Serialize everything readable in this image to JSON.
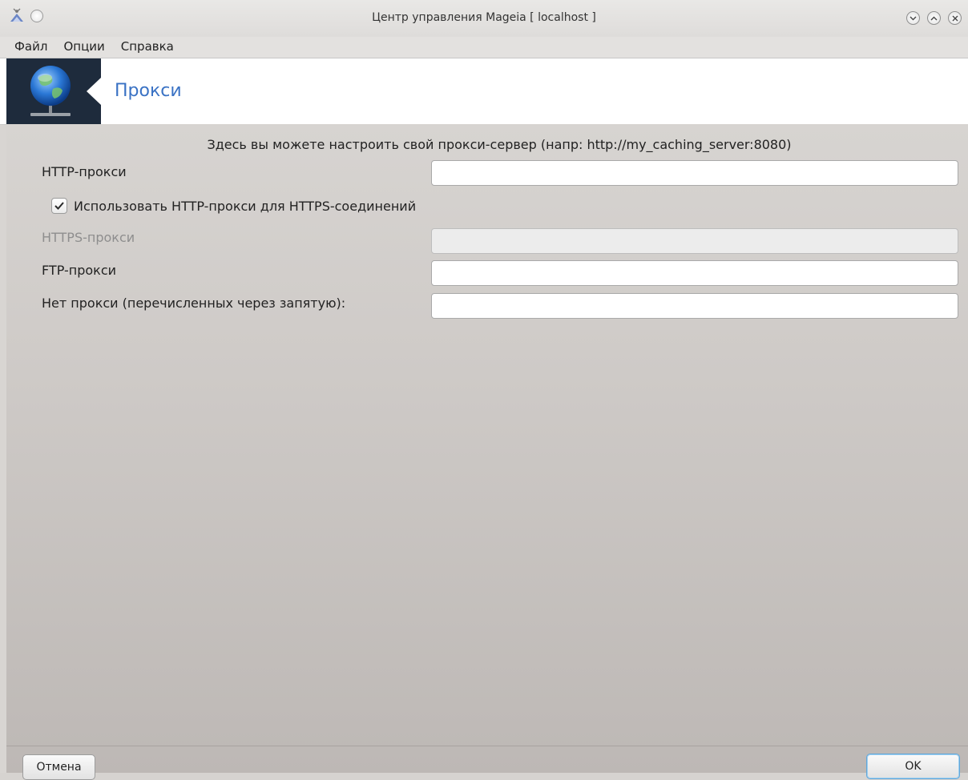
{
  "window": {
    "title": "Центр управления Mageia  [ localhost ]"
  },
  "menubar": {
    "items": [
      {
        "label": "Файл"
      },
      {
        "label": "Опции"
      },
      {
        "label": "Справка"
      }
    ]
  },
  "banner": {
    "title": "Прокси",
    "icon": "network-globe-icon"
  },
  "form": {
    "intro": "Здесь вы можете настроить свой прокси-сервер (напр: http://my_caching_server:8080)",
    "http_label": "HTTP-прокси",
    "http_value": "",
    "use_http_for_https_label": "Использовать HTTP-прокси для HTTPS-соединений",
    "use_http_for_https_checked": true,
    "https_label": "HTTPS-прокси",
    "https_value": "",
    "ftp_label": "FTP-прокси",
    "ftp_value": "",
    "no_proxy_label": "Нет прокси (перечисленных через запятую):",
    "no_proxy_value": ""
  },
  "footer": {
    "cancel_label": "Отмена",
    "ok_label": "OK"
  },
  "colors": {
    "banner_title": "#3a72c4",
    "banner_icon_bg": "#1e2b3c",
    "ok_focus": "#61a7db"
  }
}
